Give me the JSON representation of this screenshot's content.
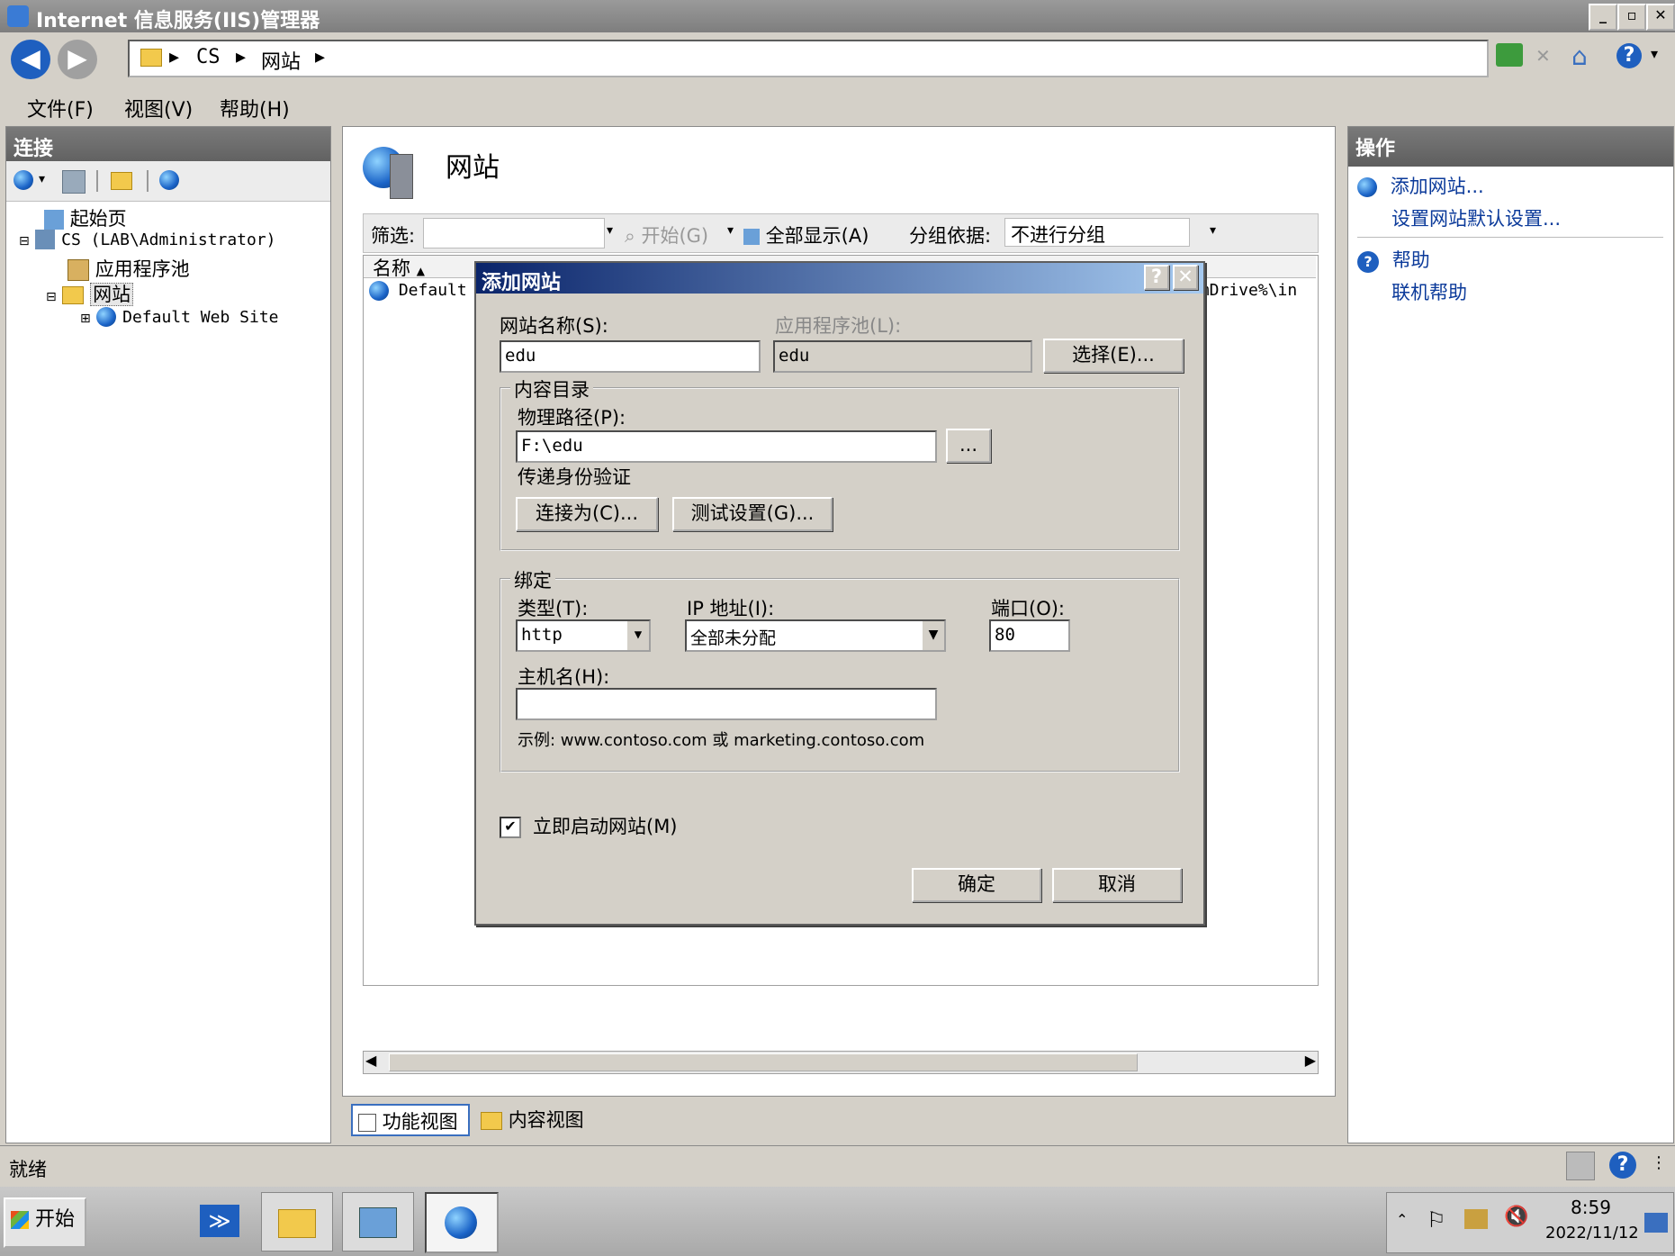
{
  "window": {
    "title": "Internet 信息服务(IIS)管理器"
  },
  "address": {
    "crumbs": [
      "CS",
      "网站"
    ]
  },
  "menu": {
    "file": "文件(F)",
    "view": "视图(V)",
    "help": "帮助(H)"
  },
  "connections": {
    "header": "连接",
    "tree": {
      "start_page": "起始页",
      "server": "CS (LAB\\Administrator)",
      "app_pools": "应用程序池",
      "sites": "网站",
      "default_site": "Default Web Site"
    }
  },
  "center": {
    "title": "网站",
    "filter_label": "筛选:",
    "start_label": "开始(G)",
    "show_all_label": "全部显示(A)",
    "group_by_label": "分组依据:",
    "group_by_value": "不进行分组",
    "col_name": "名称",
    "row_name": "Default",
    "row_path": "emDrive%\\in",
    "tab_features": "功能视图",
    "tab_content": "内容视图"
  },
  "actions": {
    "header": "操作",
    "add_site": "添加网站...",
    "set_defaults": "设置网站默认设置...",
    "help": "帮助",
    "online_help": "联机帮助"
  },
  "dialog": {
    "title": "添加网站",
    "help_btn": "?",
    "close_btn": "✕",
    "site_name_label": "网站名称(S):",
    "site_name_value": "edu",
    "app_pool_label": "应用程序池(L):",
    "app_pool_value": "edu",
    "select_btn": "选择(E)...",
    "content_dir_legend": "内容目录",
    "physical_path_label": "物理路径(P):",
    "physical_path_value": "F:\\edu",
    "browse_btn": "...",
    "pass_auth_label": "传递身份验证",
    "connect_as_btn": "连接为(C)...",
    "test_settings_btn": "测试设置(G)...",
    "binding_legend": "绑定",
    "type_label": "类型(T):",
    "type_value": "http",
    "ip_label": "IP 地址(I):",
    "ip_value": "全部未分配",
    "port_label": "端口(O):",
    "port_value": "80",
    "host_label": "主机名(H):",
    "host_value": "",
    "example_text": "示例: www.contoso.com 或 marketing.contoso.com",
    "start_now_label": "立即启动网站(M)",
    "start_now_checked": true,
    "ok_btn": "确定",
    "cancel_btn": "取消"
  },
  "status": {
    "text": "就绪"
  },
  "taskbar": {
    "start": "开始",
    "time": "8:59",
    "date": "2022/11/12"
  }
}
